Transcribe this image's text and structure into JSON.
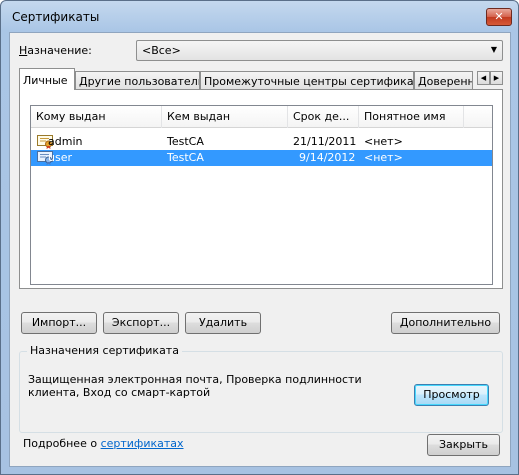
{
  "window": {
    "title": "Сертификаты",
    "close_label": "✕"
  },
  "purpose": {
    "label": "Назначение:",
    "label_accel": "Н",
    "label_rest": "азначение:",
    "value": "<Все>"
  },
  "tabs": [
    {
      "label": "Личные"
    },
    {
      "label": "Другие пользователи"
    },
    {
      "label": "Промежуточные центры сертификации"
    },
    {
      "label": "Доверенн"
    }
  ],
  "tab_scroll": {
    "left": "◀",
    "right": "▶"
  },
  "list": {
    "columns": [
      "Кому выдан",
      "Кем выдан",
      "Срок де...",
      "Понятное имя"
    ],
    "rows": [
      {
        "issued_to": "admin",
        "issued_by": "TestCA",
        "expires": "21/11/2011",
        "friendly_name": "<нет>",
        "icon": "certificate-icon"
      },
      {
        "issued_to": "user",
        "issued_by": "TestCA",
        "expires": "9/14/2012",
        "friendly_name": "<нет>",
        "icon": "certificate-icon",
        "selected": true
      }
    ]
  },
  "buttons": {
    "import": "Импорт...",
    "export": "Экспорт...",
    "delete": "Удалить",
    "advanced": "Дополнительно",
    "view": "Просмотр",
    "close": "Закрыть"
  },
  "purposes_group": {
    "title": "Назначения сертификата",
    "text": "Защищенная электронная почта, Проверка подлинности клиента, Вход со смарт-картой"
  },
  "footer": {
    "more_prefix": "Подробнее о ",
    "more_link": "сертификатах"
  },
  "colors": {
    "selection": "#3399ff",
    "link": "#0066cc"
  }
}
